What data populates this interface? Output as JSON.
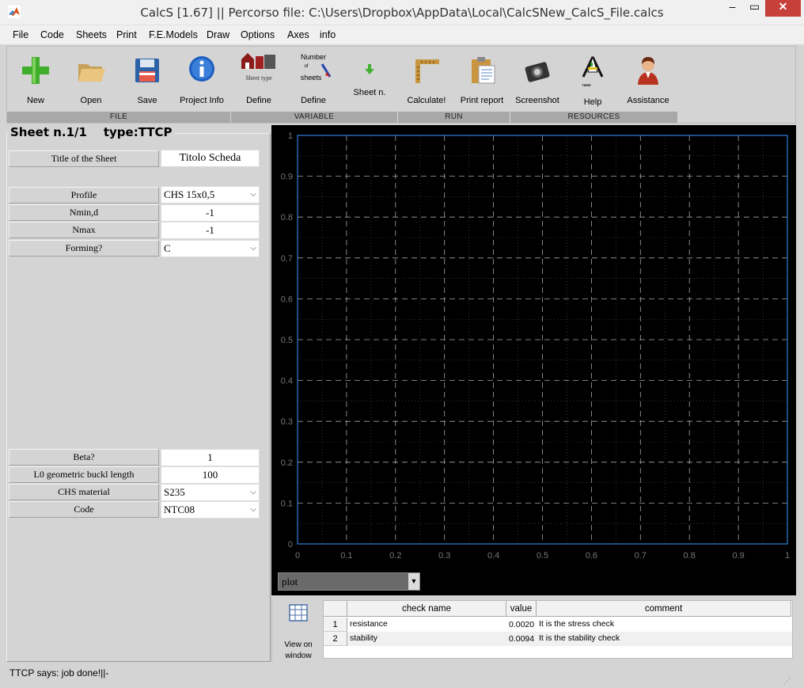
{
  "window": {
    "title": "CalcS [1.67] || Percorso file: C:\\Users\\Dropbox\\AppData\\Local\\CalcSNew_CalcS_File.calcs",
    "minimize_glyph": "–",
    "maximize_glyph": "▭",
    "close_glyph": "✕"
  },
  "menu": [
    "File",
    "Code",
    "Sheets",
    "Print",
    "F.E.Models",
    "Draw",
    "Options",
    "Axes",
    "info"
  ],
  "toolbar": {
    "tools": [
      {
        "label": "New",
        "icon": "plus-icon"
      },
      {
        "label": "Open",
        "icon": "folder-icon"
      },
      {
        "label": "Save",
        "icon": "floppy-icon"
      },
      {
        "label": "Project Info",
        "icon": "info-icon"
      },
      {
        "label": "Define",
        "icon": "sheet-type-icon",
        "caption": "Sheet type"
      },
      {
        "label": "Define",
        "icon": "number-of-sheets-icon",
        "caption_lines": [
          "Number",
          "of",
          "sheets"
        ]
      },
      {
        "label": "Sheet n.",
        "icon": "down-arrow-icon"
      },
      {
        "label": "Calculate!",
        "icon": "ruler-icon"
      },
      {
        "label": "Print report",
        "icon": "clipboard-icon"
      },
      {
        "label": "Screenshot",
        "icon": "camera-icon"
      },
      {
        "label": "Help",
        "icon": "help-logo-icon",
        "caption": "TWEE"
      },
      {
        "label": "Assistance",
        "icon": "assistant-icon"
      }
    ],
    "groups": [
      "FILE",
      "VARIABLE",
      "RUN",
      "RESOURCES"
    ]
  },
  "sheet": {
    "header": "Sheet n.1/1",
    "type_label": "type:TTCP",
    "title_label": "Title of the Sheet",
    "title_value": "Titolo Scheda",
    "profile_label": "Profile",
    "profile_value": "CHS 15x0,5",
    "nmin_label": "Nmin,d",
    "nmin_value": "-1",
    "nmax_label": "Nmax",
    "nmax_value": "-1",
    "forming_label": "Forming?",
    "forming_value": "C",
    "beta_label": "Beta?",
    "beta_value": "1",
    "l0_label": "L0 geometric buckl length",
    "l0_value": "100",
    "material_label": "CHS material",
    "material_value": "S235",
    "code_label": "Code",
    "code_value": "NTC08"
  },
  "plot": {
    "selector_value": "plot",
    "axis_color": "#2f7fd8",
    "grid_color": "#cfcfcf",
    "tick_label_color": "#777777",
    "x_ticks": [
      "0",
      "0.1",
      "0.2",
      "0.3",
      "0.4",
      "0.5",
      "0.6",
      "0.7",
      "0.8",
      "0.9",
      "1"
    ],
    "y_ticks": [
      "0",
      "0.1",
      "0.2",
      "0.3",
      "0.4",
      "0.5",
      "0.6",
      "0.7",
      "0.8",
      "0.9",
      "1"
    ]
  },
  "results": {
    "view_label_1": "View on",
    "view_label_2": "window",
    "headers": [
      "check name",
      "value",
      "comment"
    ],
    "rows": [
      {
        "n": "1",
        "name": "resistance",
        "value": "0.0020",
        "comment": "It is the stress check"
      },
      {
        "n": "2",
        "name": "stability",
        "value": "0.0094",
        "comment": "It is the stability check"
      }
    ]
  },
  "status": {
    "text": "TTCP says: job done!||-"
  }
}
